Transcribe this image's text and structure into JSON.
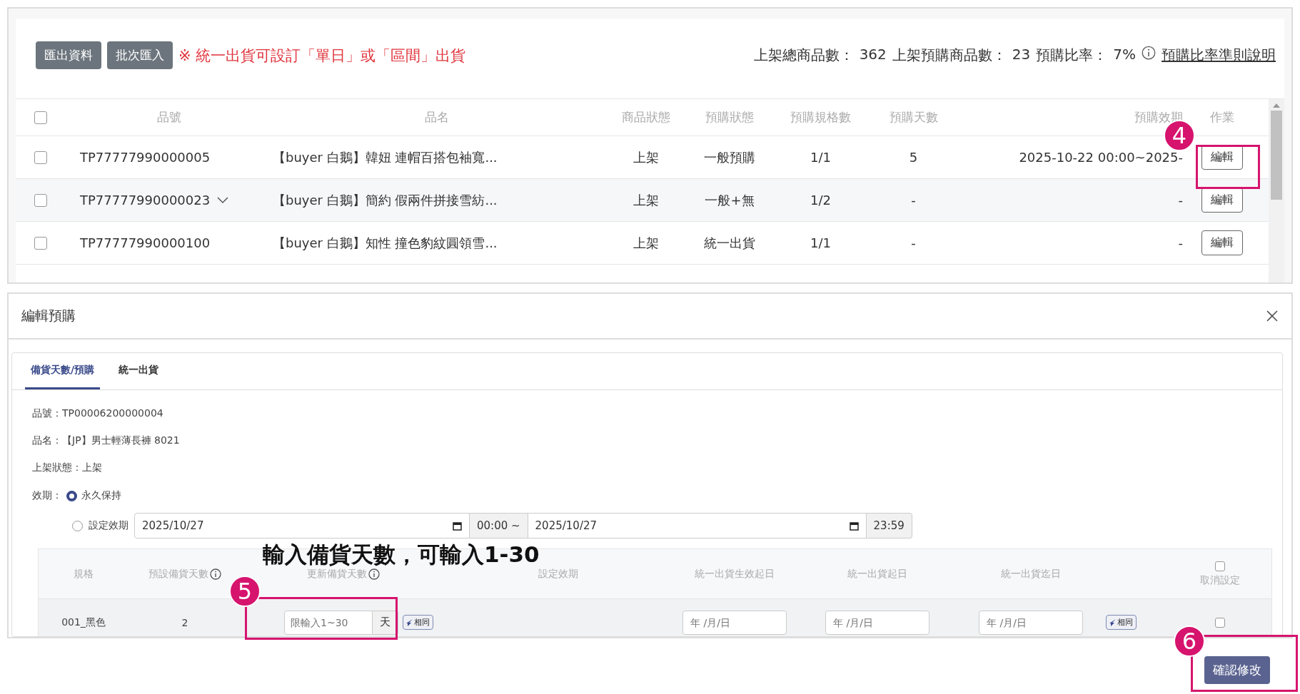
{
  "toolbar": {
    "buttons": [
      "匯出資料",
      "批次匯入"
    ],
    "notice": "※ 統一出貨可設訂「單日」或「區間」出貨",
    "stats": [
      {
        "label": "上架總商品數：",
        "value": "362"
      },
      {
        "label": "上架預購商品數：",
        "value": "23"
      },
      {
        "label": "預購比率：",
        "value": "7%"
      }
    ],
    "link": "預購比率準則說明"
  },
  "product_table": {
    "select_all": {
      "checked": false
    },
    "columns": [
      "品號",
      "品名",
      "商品狀態",
      "預購狀態",
      "預購規格數",
      "預購天數",
      "預購效期",
      "作業"
    ],
    "rows": [
      {
        "checked": false,
        "expandable": false,
        "cells": [
          "TP77777990000005",
          "【buyer 白鵝】韓妞 連帽百搭包袖寬...",
          "上架",
          "一般預購",
          "1/1",
          "5",
          "2025-10-22 00:00~2025-"
        ],
        "action": "編輯"
      },
      {
        "checked": false,
        "expandable": true,
        "cells": [
          "TP77777990000023",
          "【buyer 白鵝】簡約 假兩件拼接雪紡...",
          "上架",
          "一般+無",
          "1/2",
          "-",
          "-"
        ],
        "action": "編輯"
      },
      {
        "checked": false,
        "expandable": false,
        "cells": [
          "TP77777990000100",
          "【buyer 白鵝】知性 撞色豹紋圓領雪...",
          "上架",
          "統一出貨",
          "1/1",
          "-",
          "-"
        ],
        "action": "編輯"
      }
    ]
  },
  "dialog": {
    "title": "編輯預購",
    "tabs": [
      {
        "label": "備貨天數/預購",
        "selected": true
      },
      {
        "label": "統一出貨",
        "selected": false
      }
    ],
    "info": [
      "品號：TP00006200000004",
      "品名：【JP】男士輕薄長褲 8021",
      "上架狀態：上架"
    ],
    "validity": {
      "label": "效期：",
      "options": [
        {
          "label": "永久保持",
          "selected": true
        },
        {
          "label": "設定效期",
          "selected": false
        }
      ],
      "start_date": "2025/10/27",
      "start_time": "00:00 ~",
      "end_date": "2025/10/27",
      "end_time": "23:59"
    },
    "spec_table": {
      "columns": [
        {
          "label": "規格",
          "info": false
        },
        {
          "label": "預設備貨天數",
          "info": true
        },
        {
          "label": "更新備貨天數",
          "info": true
        },
        {
          "label": "設定效期",
          "info": false
        },
        {
          "label": "統一出貨生效起日",
          "info": false
        },
        {
          "label": "統一出貨起日",
          "info": false
        },
        {
          "label": "統一出貨迄日",
          "info": false
        },
        {
          "label": "取消設定",
          "info": false
        }
      ],
      "cancel_all": {
        "checked": false
      },
      "rows": [
        {
          "spec": "001_黑色",
          "default_days": "2",
          "days_placeholder": "限輸入1~30",
          "days_unit": "天",
          "copy_button": "相同",
          "date_placeholders": [
            "年 /月/日",
            "年 /月/日",
            "年 /月/日"
          ],
          "date_copy_button": "相同",
          "cancel": {
            "checked": false
          }
        }
      ]
    }
  },
  "confirm_button": "確認修改",
  "callout": "輸入備貨天數，可輸入1-30",
  "markers": [
    "4",
    "5",
    "6"
  ]
}
